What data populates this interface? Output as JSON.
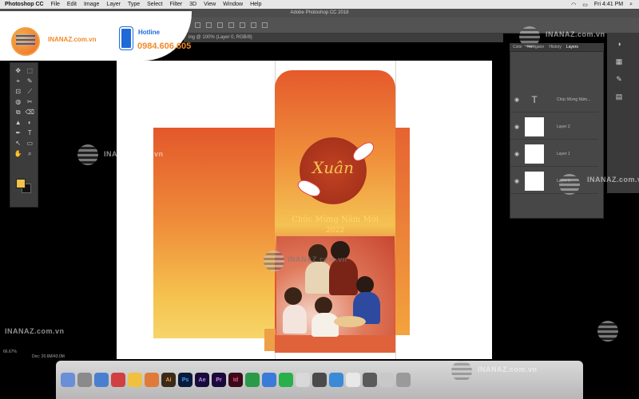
{
  "menubar": {
    "app": "Photoshop CC",
    "items": [
      "File",
      "Edit",
      "Image",
      "Layer",
      "Type",
      "Select",
      "Filter",
      "3D",
      "View",
      "Window",
      "Help"
    ],
    "clock": "Fri 4:41 PM"
  },
  "window": {
    "title": "Adobe Photoshop CC 2018",
    "doc_tab": "ing @ 100% (Layer 0, RGB/8)"
  },
  "banner": {
    "brand": "INANAZ.com.vn",
    "hotline_label": "Hotline",
    "hotline_number": "0984.606.605"
  },
  "watermarks": {
    "text": "INANAZ.com.vn",
    "short": "INANAZ.com.vn"
  },
  "envelope": {
    "emblem_text": "Xuân",
    "greeting": "Chúc Mừng Năm Mới",
    "year": "2022"
  },
  "layers_panel": {
    "tabs": [
      "Color",
      "Navigator",
      "History",
      "Layers"
    ],
    "active_tab": "Layers",
    "layers": [
      {
        "name": "Chúc Mừng Năm...",
        "kind": "text"
      },
      {
        "name": "Layer 2",
        "kind": "image"
      },
      {
        "name": "Layer 1",
        "kind": "image"
      },
      {
        "name": "Layer 0",
        "kind": "image"
      }
    ]
  },
  "status": {
    "zoom": "66.67%",
    "doc": "Doc: 20.6M/43.0M"
  },
  "tools": [
    "✥",
    "⬚",
    "⌖",
    "✎",
    "⊡",
    "⟋",
    "◍",
    "✂",
    "⧉",
    "⌫",
    "▲",
    "◐",
    "✒",
    "T",
    "↖",
    "▭",
    "✋",
    "⌕"
  ],
  "dock": {
    "apps": [
      "Ai",
      "Ps",
      "Ae",
      "Pr",
      "Id"
    ]
  },
  "colors": {
    "accent": "#f08a2a",
    "hotline_blue": "#1e6ad8",
    "foreground": "#f2c24a",
    "background": "#111111"
  }
}
